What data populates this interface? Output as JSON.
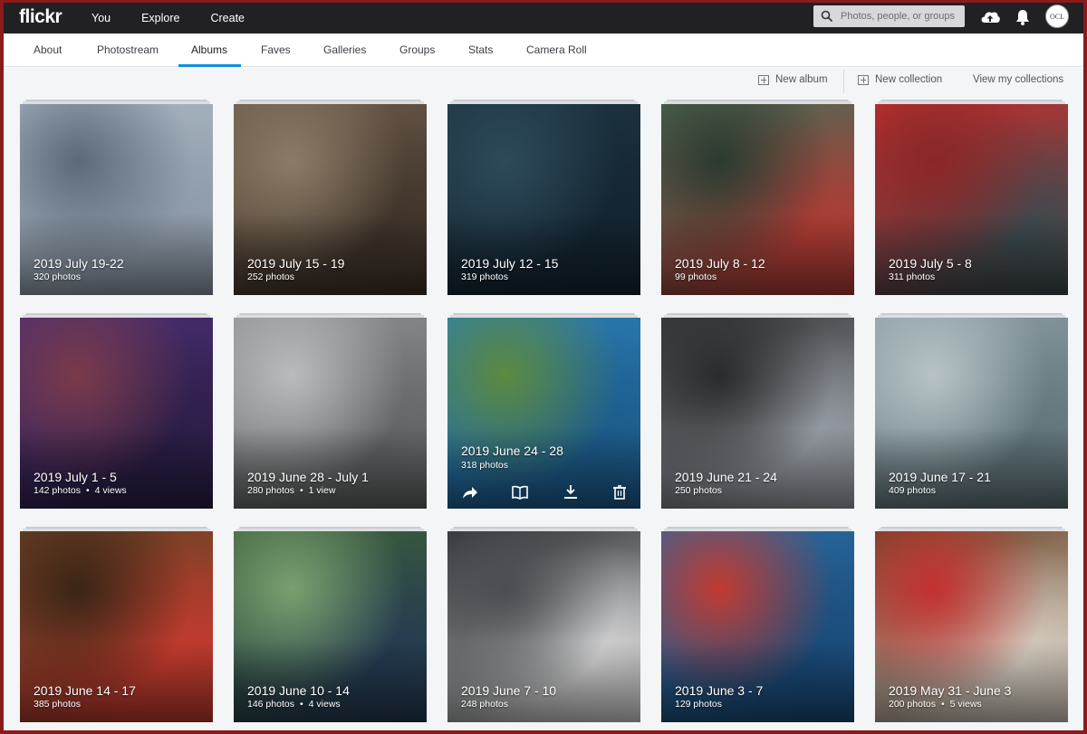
{
  "app": {
    "logo": "flickr"
  },
  "topnav": {
    "you": "You",
    "explore": "Explore",
    "create": "Create"
  },
  "search": {
    "placeholder": "Photos, people, or groups"
  },
  "avatar": {
    "text": "OCL"
  },
  "tabs": [
    "About",
    "Photostream",
    "Albums",
    "Faves",
    "Galleries",
    "Groups",
    "Stats",
    "Camera Roll"
  ],
  "active_tab": "Albums",
  "actions": {
    "new_album": "New album",
    "new_collection": "New collection",
    "view_collections": "View my collections"
  },
  "albums": [
    {
      "title": "2019 July 19-22",
      "photos": "320 photos",
      "views": "",
      "palette": [
        "#a9b6c2",
        "#8c99a6",
        "#5c6a78"
      ]
    },
    {
      "title": "2019 July 15 - 19",
      "photos": "252 photos",
      "views": "",
      "palette": [
        "#6a5a4a",
        "#3e3229",
        "#8b7b66"
      ]
    },
    {
      "title": "2019 July 12 - 15",
      "photos": "319 photos",
      "views": "",
      "palette": [
        "#1e3442",
        "#132430",
        "#2d4a5a"
      ]
    },
    {
      "title": "2019 July 8 - 12",
      "photos": "99 photos",
      "views": "",
      "palette": [
        "#4d6a55",
        "#b23a34",
        "#2b3a30"
      ]
    },
    {
      "title": "2019 July 5 - 8",
      "photos": "311 photos",
      "views": "",
      "palette": [
        "#c4302f",
        "#3a4a4f",
        "#8a2626"
      ]
    },
    {
      "title": "2019 July 1 - 5",
      "photos": "142 photos",
      "views": "4 views",
      "palette": [
        "#4b2f73",
        "#2a1d45",
        "#7a3a4a"
      ]
    },
    {
      "title": "2019 June 28 - July 1",
      "photos": "280 photos",
      "views": "1 view",
      "palette": [
        "#8c9090",
        "#5f6363",
        "#b9bcbc"
      ]
    },
    {
      "title": "2019 June 24 - 28",
      "photos": "318 photos",
      "views": "",
      "palette": [
        "#2d7db4",
        "#1b5a8a",
        "#5c8a3e"
      ]
    },
    {
      "title": "2019 June 21 - 24",
      "photos": "250 photos",
      "views": "",
      "palette": [
        "#3a3c3e",
        "#9aa0a8",
        "#2a2b2c"
      ]
    },
    {
      "title": "2019 June 17 - 21",
      "photos": "409 photos",
      "views": "",
      "palette": [
        "#8a9ca2",
        "#5f7379",
        "#b7c3c6"
      ]
    },
    {
      "title": "2019 June 14 - 17",
      "photos": "385 photos",
      "views": "",
      "palette": [
        "#6b4326",
        "#c53a2e",
        "#3a2515"
      ]
    },
    {
      "title": "2019 June 10 - 14",
      "photos": "146 photos",
      "views": "4 views",
      "palette": [
        "#3b5f3a",
        "#243a52",
        "#7aa070"
      ]
    },
    {
      "title": "2019 June 7 - 10",
      "photos": "248 photos",
      "views": "",
      "palette": [
        "#2e3236",
        "#d8d8d8",
        "#4a4e52"
      ]
    },
    {
      "title": "2019 June 3 - 7",
      "photos": "129 photos",
      "views": "",
      "palette": [
        "#2a6aa0",
        "#1a4a78",
        "#c23a30"
      ]
    },
    {
      "title": "2019 May 31 - June 3",
      "photos": "200 photos",
      "views": "5 views",
      "palette": [
        "#6a4528",
        "#d8d0c4",
        "#c4302f"
      ]
    }
  ]
}
